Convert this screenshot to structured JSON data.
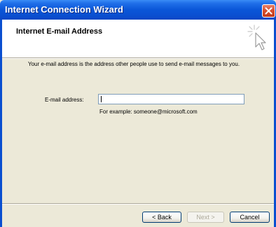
{
  "window": {
    "title": "Internet Connection Wizard",
    "close_icon": "close-icon"
  },
  "header": {
    "title": "Internet E-mail Address",
    "icon": "wizard-cursor-icon"
  },
  "content": {
    "description": "Your e-mail address is the address other people use to send e-mail messages to you.",
    "email_label": "E-mail address:",
    "email_value": "",
    "example": "For example: someone@microsoft.com"
  },
  "buttons": {
    "back": "< Back",
    "next": "Next >",
    "cancel": "Cancel"
  },
  "colors": {
    "titlebar": "#0a56d8",
    "face": "#ece9d8",
    "close": "#d9502e"
  }
}
